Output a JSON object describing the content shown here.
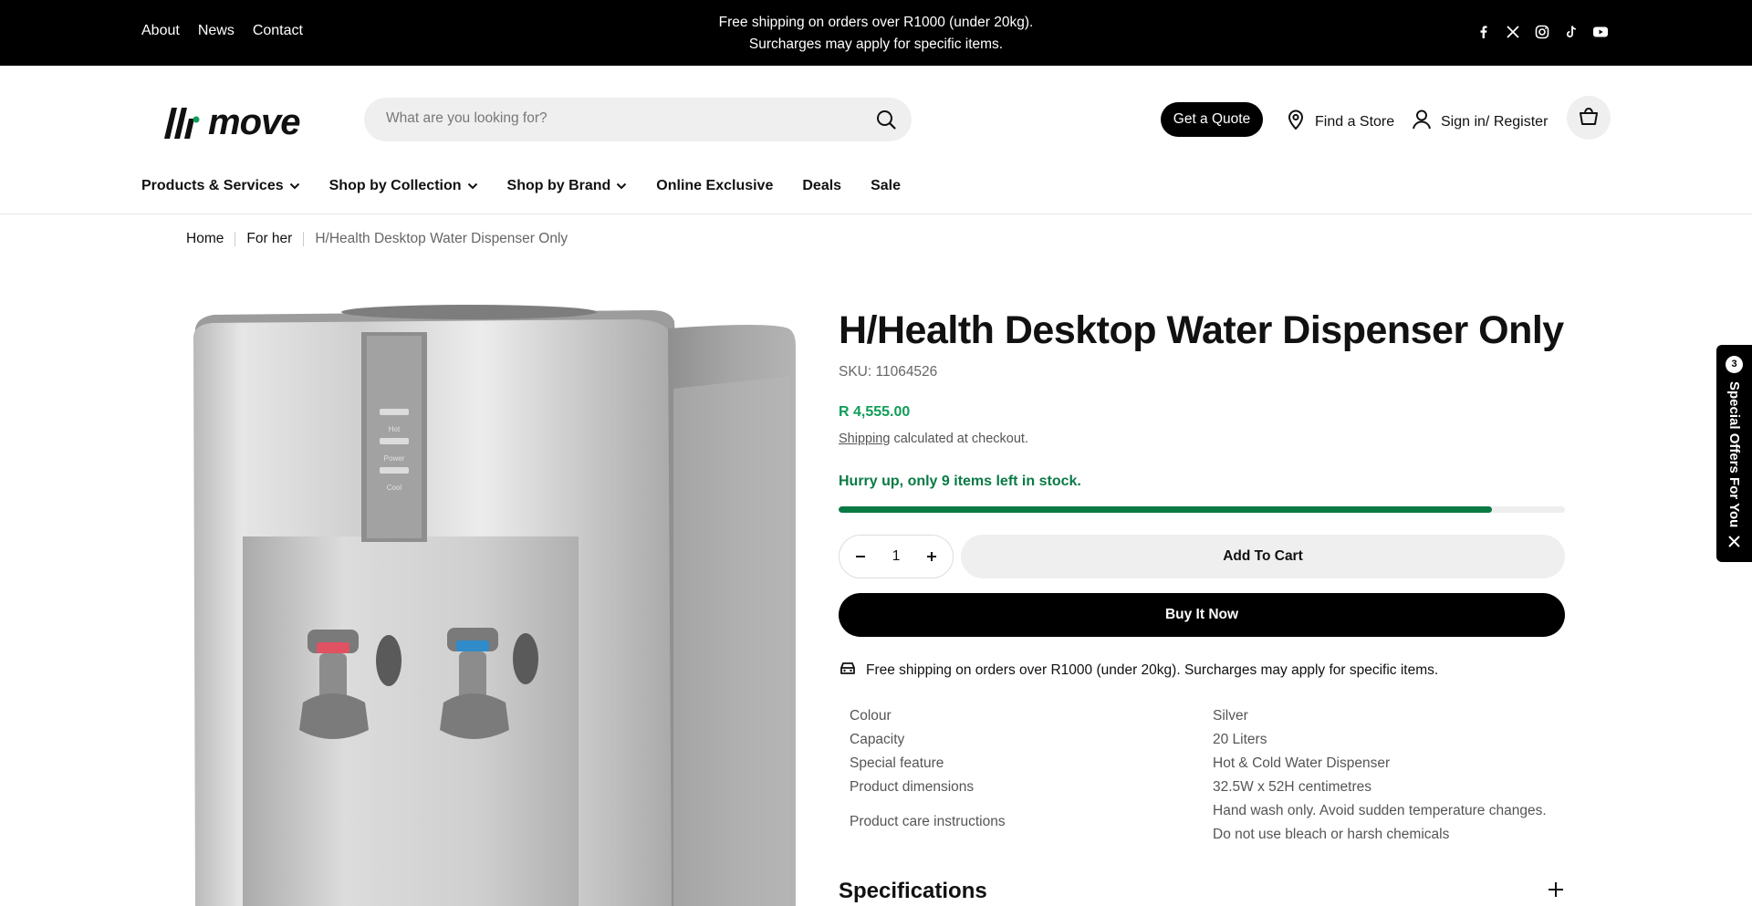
{
  "topbar": {
    "links": [
      "About",
      "News",
      "Contact"
    ],
    "promo_line1": "Free shipping on orders over R1000 (under 20kg).",
    "promo_line2": "Surcharges may apply for specific items.",
    "social_icons": [
      "facebook-icon",
      "x-icon",
      "instagram-icon",
      "tiktok-icon",
      "youtube-icon"
    ]
  },
  "header": {
    "logo_text": "move",
    "search_placeholder": "What are you looking for?",
    "quote_label": "Get a Quote",
    "store_label": "Find a Store",
    "account_label": "Sign in/ Register"
  },
  "nav": {
    "items": [
      {
        "label": "Products & Services",
        "dropdown": true
      },
      {
        "label": "Shop by Collection",
        "dropdown": true
      },
      {
        "label": "Shop by Brand",
        "dropdown": true
      },
      {
        "label": "Online Exclusive",
        "dropdown": false
      },
      {
        "label": "Deals",
        "dropdown": false
      },
      {
        "label": "Sale",
        "dropdown": false
      }
    ]
  },
  "breadcrumb": {
    "home": "Home",
    "category": "For her",
    "current": "H/Health Desktop Water Dispenser Only"
  },
  "product": {
    "title": "H/Health Desktop Water Dispenser Only",
    "sku": "SKU: 11064526",
    "price": "R 4,555.00",
    "shipping_link": "Shipping",
    "shipping_rest": " calculated at checkout.",
    "stock_msg": "Hurry up, only 9 items left in stock.",
    "stock_fraction": 0.9,
    "quantity": "1",
    "add_to_cart": "Add To Cart",
    "buy_now": "Buy It Now",
    "free_shipping": "Free shipping on orders over R1000 (under 20kg). Surcharges may apply for specific items.",
    "image_labels": [
      "Hot",
      "Power",
      "Cool"
    ],
    "specs": [
      {
        "k": "Colour",
        "v": "Silver"
      },
      {
        "k": "Capacity",
        "v": "20 Liters"
      },
      {
        "k": "Special feature",
        "v": "Hot & Cold Water Dispenser"
      },
      {
        "k": "Product dimensions",
        "v": "32.5W x 52H centimetres"
      },
      {
        "k": "Product care instructions",
        "v": "Hand wash only. Avoid sudden temperature changes.",
        "v2": "Do not use bleach or harsh chemicals"
      }
    ],
    "specifications_heading": "Specifications"
  },
  "sidetab": {
    "count": "3",
    "label": "Special Offers For You"
  },
  "colors": {
    "price_green": "#0f9d58",
    "stock_green": "#0a7a45",
    "black": "#000000"
  }
}
